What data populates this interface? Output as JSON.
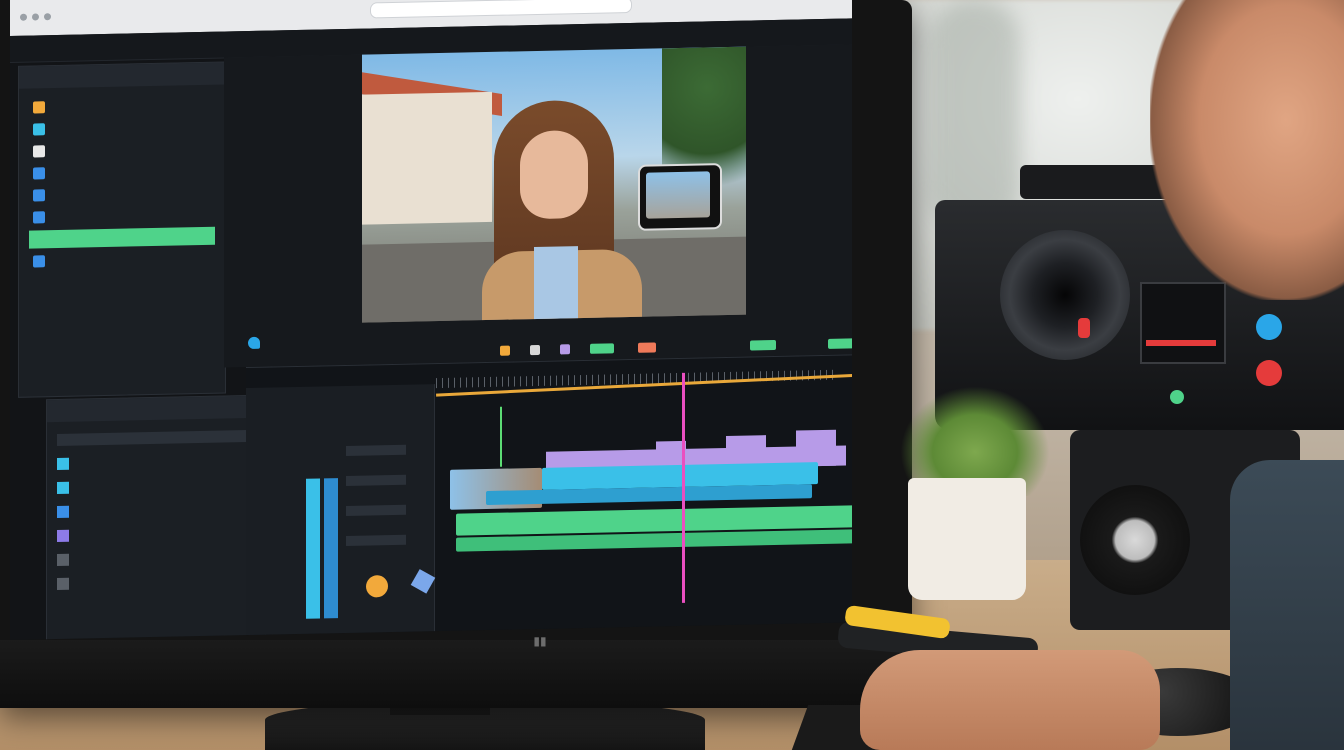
{
  "app": {
    "brand_label": "",
    "preview_label": "",
    "media_panel_title": "",
    "effects_panel_title": ""
  },
  "menu": {
    "items": [
      "",
      "",
      "",
      "",
      "",
      ""
    ]
  },
  "media_items": [
    {
      "label": "",
      "color": "#f2a93b"
    },
    {
      "label": "",
      "color": "#3ac0e8"
    },
    {
      "label": "",
      "color": "#e8e8e8"
    },
    {
      "label": "",
      "color": "#3a8fe8"
    },
    {
      "label": "",
      "color": "#3a8fe8"
    },
    {
      "label": "",
      "color": "#3a8fe8"
    },
    {
      "label": "",
      "color": "#4fd38a",
      "active": true
    },
    {
      "label": "",
      "color": "#3a8fe8"
    }
  ],
  "colors": {
    "accent_green": "#4fd38a",
    "playhead": "#ea4fc0",
    "clip_blue": "#3ac0e8",
    "clip_green": "#4fd38a",
    "audio_wave": "#b79be8",
    "timeline_marker": "#e9a83a"
  },
  "icons": [
    "search-icon",
    "camera-icon",
    "lens-icon",
    "playhead-icon",
    "knob-icon"
  ]
}
